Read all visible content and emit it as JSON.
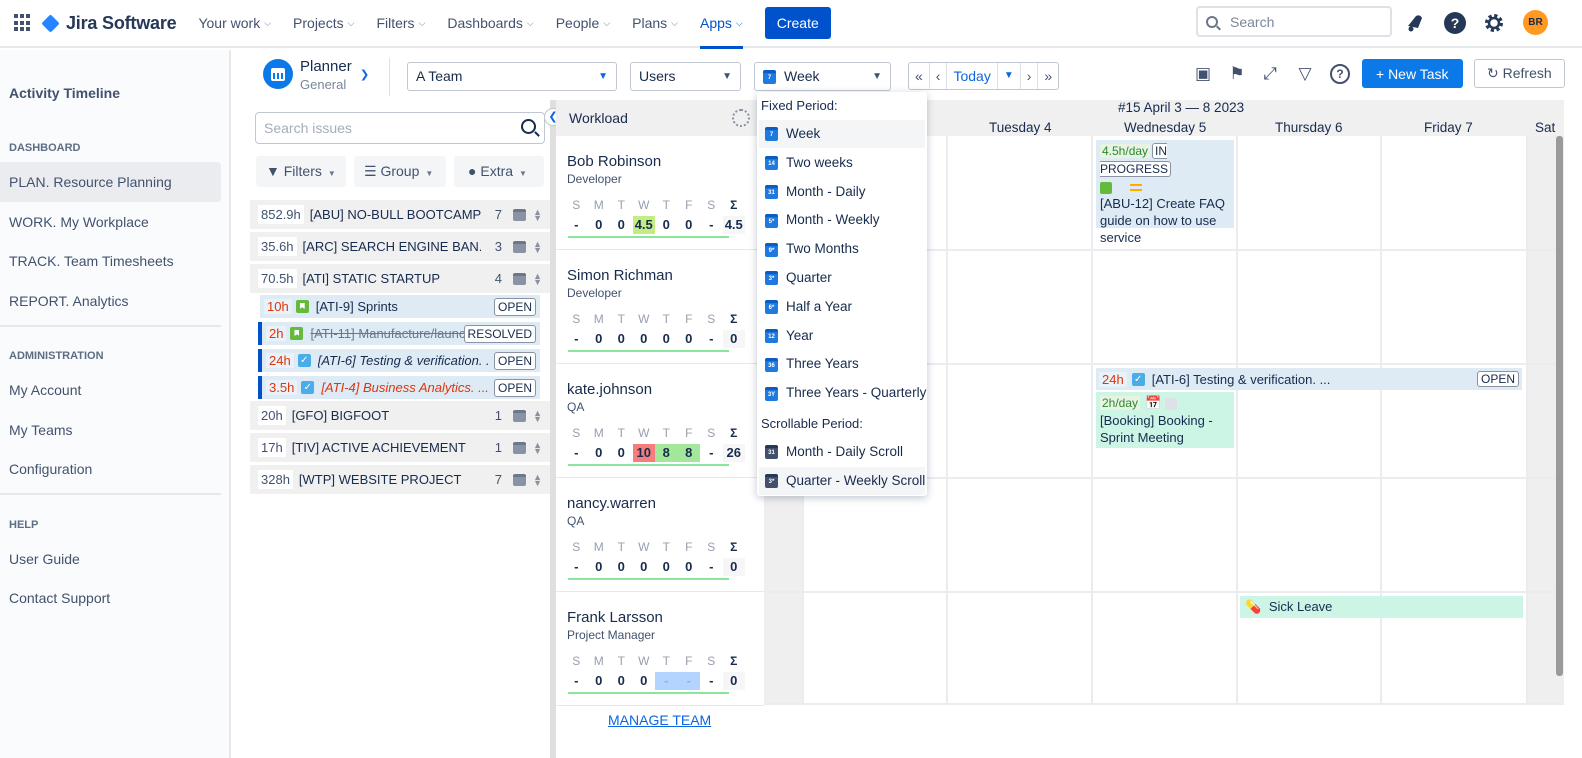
{
  "topnav": {
    "product": "Jira Software",
    "items": [
      {
        "label": "Your work"
      },
      {
        "label": "Projects"
      },
      {
        "label": "Filters"
      },
      {
        "label": "Dashboards"
      },
      {
        "label": "People"
      },
      {
        "label": "Plans"
      },
      {
        "label": "Apps",
        "active": true
      }
    ],
    "create_label": "Create",
    "search_placeholder": "Search",
    "avatar_initials": "BR"
  },
  "sidebar": {
    "title": "Activity Timeline",
    "sections": [
      {
        "heading": "DASHBOARD",
        "items": [
          "PLAN. Resource Planning",
          "WORK. My Workplace",
          "TRACK. Team Timesheets",
          "REPORT. Analytics"
        ]
      },
      {
        "heading": "ADMINISTRATION",
        "items": [
          "My Account",
          "My Teams",
          "Configuration"
        ]
      },
      {
        "heading": "HELP",
        "items": [
          "User Guide",
          "Contact Support"
        ]
      }
    ],
    "active_item": "PLAN. Resource Planning"
  },
  "toolbar": {
    "planner_title": "Planner",
    "planner_sub": "General",
    "team_select": "A Team",
    "users_select": "Users",
    "period_select": "Week",
    "period_icon_num": "7",
    "today_label": "Today",
    "new_task_label": "+ New Task",
    "refresh_label": "Refresh"
  },
  "issues": {
    "search_placeholder": "Search issues",
    "filters_label": "Filters",
    "group_label": "Group",
    "extra_label": "Extra",
    "projects": [
      {
        "hours": "852.9h",
        "name": "[ABU] NO-BULL BOOTCAMP",
        "count": "7"
      },
      {
        "hours": "35.6h",
        "name": "[ARC] SEARCH ENGINE BAN...",
        "count": "3"
      },
      {
        "hours": "70.5h",
        "name": "[ATI] STATIC STARTUP",
        "count": "4"
      },
      {
        "hours": "20h",
        "name": "[GFO] BIGFOOT",
        "count": "1"
      },
      {
        "hours": "17h",
        "name": "[TIV] ACTIVE ACHIEVEMENT",
        "count": "1"
      },
      {
        "hours": "328h",
        "name": "[WTP] WEBSITE PROJECT",
        "count": "7"
      }
    ],
    "tasks": [
      {
        "hours": "10h",
        "name": "[ATI-9] Sprints",
        "status": "OPEN",
        "type": "story"
      },
      {
        "hours": "2h",
        "name": "[ATI-11] Manufacture/launc...",
        "status": "RESOLVED",
        "type": "story"
      },
      {
        "hours": "24h",
        "name": "[ATI-6] Testing & verification. ...",
        "status": "OPEN",
        "type": "task"
      },
      {
        "hours": "3.5h",
        "name": "[ATI-4] Business Analytics. ...",
        "status": "OPEN",
        "type": "task"
      }
    ]
  },
  "workload": {
    "title": "Workload",
    "day_letters": [
      "S",
      "M",
      "T",
      "W",
      "T",
      "F",
      "S",
      "Σ"
    ],
    "people": [
      {
        "name": "Bob Robinson",
        "role": "Developer",
        "values": [
          "-",
          "0",
          "0",
          "4.5",
          "0",
          "0",
          "-",
          "4.5"
        ]
      },
      {
        "name": "Simon Richman",
        "role": "Developer",
        "values": [
          "-",
          "0",
          "0",
          "0",
          "0",
          "0",
          "-",
          "0"
        ]
      },
      {
        "name": "kate.johnson",
        "role": "QA",
        "values": [
          "-",
          "0",
          "0",
          "10",
          "8",
          "8",
          "-",
          "26"
        ]
      },
      {
        "name": "nancy.warren",
        "role": "QA",
        "values": [
          "-",
          "0",
          "0",
          "0",
          "0",
          "0",
          "-",
          "0"
        ]
      },
      {
        "name": "Frank Larsson",
        "role": "Project Manager",
        "values": [
          "-",
          "0",
          "0",
          "0",
          "-",
          "-",
          "-",
          "0"
        ]
      }
    ],
    "manage_team_label": "MANAGE TEAM"
  },
  "calendar": {
    "week_label": "#15 April 3 — 8 2023",
    "days": [
      "Tuesday 4",
      "Wednesday 5",
      "Thursday 6",
      "Friday 7",
      "Sat"
    ],
    "events": {
      "abu12": {
        "perday": "4.5h/day",
        "status": "IN PROGRESS",
        "title": "[ABU-12] Create FAQ guide on how to use service"
      },
      "ati6": {
        "hours": "24h",
        "title": "[ATI-6] Testing & verification. ...",
        "status": "OPEN"
      },
      "booking": {
        "perday": "2h/day",
        "title": "[Booking] Booking - Sprint Meeting"
      },
      "sick": {
        "title": "Sick Leave"
      }
    }
  },
  "period_menu": {
    "fixed_heading": "Fixed Period:",
    "fixed": [
      {
        "label": "Week",
        "icon": "7"
      },
      {
        "label": "Two weeks",
        "icon": "14"
      },
      {
        "label": "Month - Daily",
        "icon": "31"
      },
      {
        "label": "Month - Weekly",
        "icon": "5*"
      },
      {
        "label": "Two Months",
        "icon": "9*"
      },
      {
        "label": "Quarter",
        "icon": "3*"
      },
      {
        "label": "Half a Year",
        "icon": "6*"
      },
      {
        "label": "Year",
        "icon": "12"
      },
      {
        "label": "Three Years",
        "icon": "36"
      },
      {
        "label": "Three Years - Quarterly",
        "icon": "3Y"
      }
    ],
    "scroll_heading": "Scrollable Period:",
    "scroll": [
      {
        "label": "Month - Daily Scroll",
        "icon": "31"
      },
      {
        "label": "Quarter - Weekly Scroll",
        "icon": "3*"
      }
    ]
  }
}
